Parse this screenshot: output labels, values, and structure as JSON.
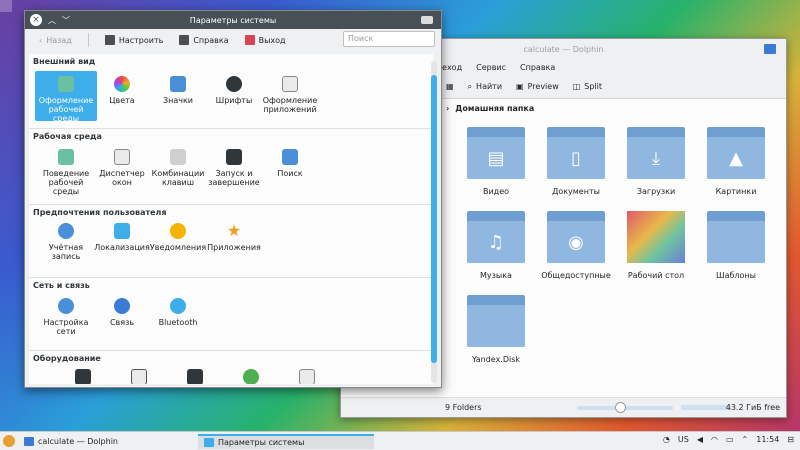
{
  "settings": {
    "title": "Параметры системы",
    "toolbar": {
      "back": "Назад",
      "configure": "Настроить",
      "help": "Справка",
      "quit": "Выход"
    },
    "search_placeholder": "Поиск",
    "sections": [
      {
        "title": "Внешний вид",
        "items": [
          "Оформление рабочей среды",
          "Цвета",
          "Значки",
          "Шрифты",
          "Оформление приложений"
        ]
      },
      {
        "title": "Рабочая среда",
        "items": [
          "Поведение рабочей среды",
          "Диспетчер окон",
          "Комбинации клавиш",
          "Запуск и завершение",
          "Поиск"
        ]
      },
      {
        "title": "Предпочтения пользователя",
        "items": [
          "Учётная запись",
          "Локализация",
          "Уведомления",
          "Приложения"
        ]
      },
      {
        "title": "Сеть и связь",
        "items": [
          "Настройка сети",
          "Связь",
          "Bluetooth"
        ]
      },
      {
        "title": "Оборудование",
        "items": []
      }
    ]
  },
  "dolphin": {
    "title": "calculate — Dolphin",
    "menu": [
      "Переход",
      "Сервис",
      "Справка"
    ],
    "tools": {
      "find": "Найти",
      "preview": "Preview",
      "split": "Split"
    },
    "breadcrumb": "Домашняя папка",
    "folders": [
      "Видео",
      "Документы",
      "Загрузки",
      "Картинки",
      "Музыка",
      "Общедоступные",
      "Рабочий стол",
      "Шаблоны",
      "Yandex.Disk"
    ],
    "status": {
      "count": "9 Folders",
      "free": "43.2 ГиБ free"
    }
  },
  "taskbar": {
    "tasks": [
      "calculate — Dolphin",
      "Параметры системы"
    ],
    "layout": "US",
    "clock": "11:54"
  }
}
